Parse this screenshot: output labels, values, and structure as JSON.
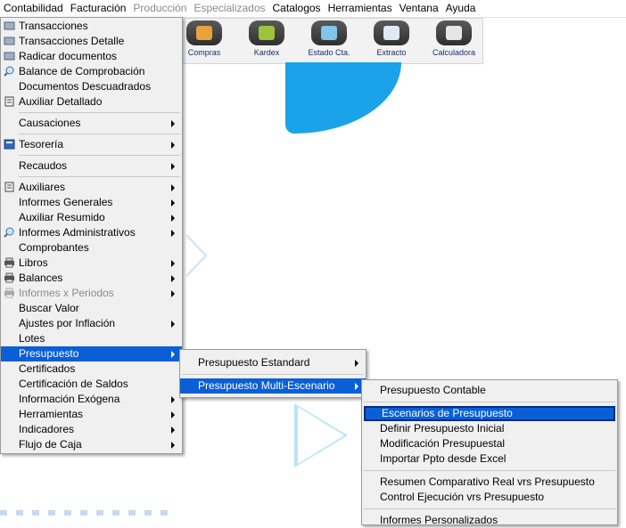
{
  "menubar": [
    "Contabilidad",
    "Facturación",
    "Producción",
    "Especializados",
    "Catalogos",
    "Herramientas",
    "Ventana",
    "Ayuda"
  ],
  "menubar_disabled": [
    false,
    false,
    true,
    true,
    false,
    false,
    false,
    false
  ],
  "toolbar": [
    "Compras",
    "Kardex",
    "Estado Cta.",
    "Extracto",
    "Calculadora"
  ],
  "main_menu": {
    "g1": [
      "Transacciones",
      "Transacciones Detalle",
      "Radicar documentos",
      "Balance de Comprobación",
      "Documentos Descuadrados",
      "Auxiliar Detallado"
    ],
    "causaciones": "Causaciones",
    "tesoreria": "Tesorería",
    "recaudos": "Recaudos",
    "g2": [
      "Auxiliares",
      "Informes Generales",
      "Auxiliar Resumido",
      "Informes Administrativos",
      "Comprobantes",
      "Libros",
      "Balances",
      "Informes x Periodos",
      "Buscar Valor",
      "Ajustes por Inflación",
      "Lotes",
      "Presupuesto",
      "Certificados",
      "Certificación de Saldos",
      "Información Exógena",
      "Herramientas",
      "Indicadores",
      "Flujo de Caja"
    ]
  },
  "submenu_presupuesto": [
    "Presupuesto Estandard",
    "Presupuesto Multi-Escenario"
  ],
  "submenu_multi": {
    "contable": "Presupuesto Contable",
    "g1": [
      "Escenarios de Presupuesto",
      "Definir Presupuesto Inicial",
      "Modificación Presupuestal",
      "Importar Ppto desde Excel"
    ],
    "g2": [
      "Resumen Comparativo  Real vrs Presupuesto",
      "Control Ejecución vrs Presupuesto"
    ],
    "g3": [
      "Informes Personalizados"
    ]
  },
  "colors": {
    "highlight": "#0a5fd6",
    "accent_wave": "#1aa3e8"
  }
}
